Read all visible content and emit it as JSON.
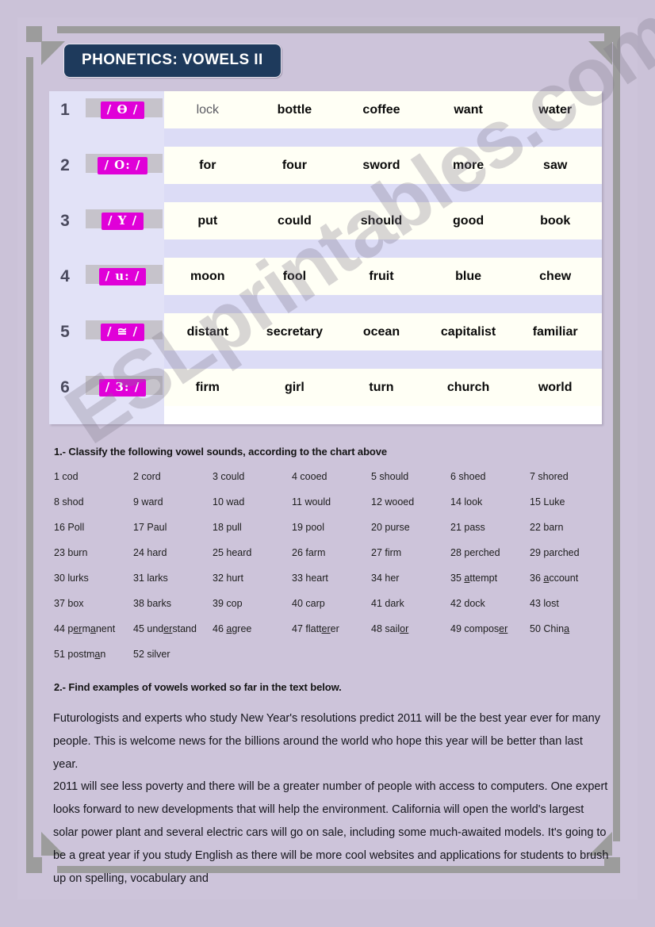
{
  "document": {
    "title": "PHONETICS: VOWELS II"
  },
  "vowel_chart": {
    "rows": [
      {
        "number": "1",
        "symbol": "/ Ɵ /",
        "words": [
          "lock",
          "bottle",
          "coffee",
          "want",
          "water"
        ]
      },
      {
        "number": "2",
        "symbol": "/ O: /",
        "words": [
          "for",
          "four",
          "sword",
          "more",
          "saw"
        ]
      },
      {
        "number": "3",
        "symbol": "/ Y /",
        "words": [
          "put",
          "could",
          "should",
          "good",
          "book"
        ]
      },
      {
        "number": "4",
        "symbol": "/ u: /",
        "words": [
          "moon",
          "fool",
          "fruit",
          "blue",
          "chew"
        ]
      },
      {
        "number": "5",
        "symbol": "/ ≅ /",
        "words": [
          "distant",
          "secretary",
          "ocean",
          "capitalist",
          "familiar"
        ]
      },
      {
        "number": "6",
        "symbol": "/ 3: /",
        "words": [
          "firm",
          "girl",
          "turn",
          "church",
          "world"
        ]
      }
    ]
  },
  "exercise1": {
    "heading": "1.- Classify the following vowel sounds, according to the chart above",
    "items": [
      "1 cod",
      "2 cord",
      "3 could",
      "4 cooed",
      "5 should",
      "6 shoed",
      "7 shored",
      "8 shod",
      "9 ward",
      "10 wad",
      "11 would",
      "12 wooed",
      "14 look",
      "15 Luke",
      "16 Poll",
      "17 Paul",
      "18 pull",
      "19 pool",
      "20 purse",
      "21 pass",
      "22 barn",
      "23 burn",
      "24 hard",
      "25 heard",
      "26 farm",
      "27 firm",
      "28 perched",
      "29 parched",
      "30 lurks",
      "31 larks",
      "32 hurt",
      "33 heart",
      "34 her",
      "35 attempt",
      "36 account",
      "37 box",
      "38 barks",
      "39 cop",
      "40 carp",
      "41 dark",
      "42 dock",
      "43 lost",
      "44 permanent",
      "45 understand",
      "46 agree",
      "47 flatterer",
      "48 sailor",
      "49 composer",
      "50 China",
      "51 postman",
      "52 silver"
    ],
    "underlined": {
      "35 attempt": "a",
      "36 account": "a",
      "44 permanent": "er,a",
      "45 understand": "er",
      "46 agree": "a",
      "47 flatterer": "er",
      "48 sailor": "or",
      "49 composer": "er",
      "50 China": "a",
      "51 postman": "a"
    }
  },
  "exercise2": {
    "heading": "2.- Find examples of vowels worked so far in the text below.",
    "paragraphs": [
      " Futurologists and experts who study New Year's resolutions predict 2011 will be the best year ever for many people. This is welcome news for the billions around the world who hope this year will be better than last year.",
      "2011 will see less poverty and there will be a greater number of people with access to computers. One expert looks forward to new developments that will help the environment. California will open the world's largest solar power plant and several electric cars will go on sale, including some much-awaited models. It's going to be a great year if you study English as there will be more cool websites and applications for students to brush up on spelling, vocabulary and"
    ]
  },
  "watermark": {
    "text": "ESLprintables.com"
  },
  "colors": {
    "page_background": "#cbc2d8",
    "title_pill": "#1e3a5c",
    "symbol_badge": "#e000d8",
    "chart_number_bg": "#e2e2f7",
    "chart_row_bg": "#fffff5",
    "chart_alt_bg": "#dcdcf6",
    "frame_gray": "#9c9c9c"
  }
}
